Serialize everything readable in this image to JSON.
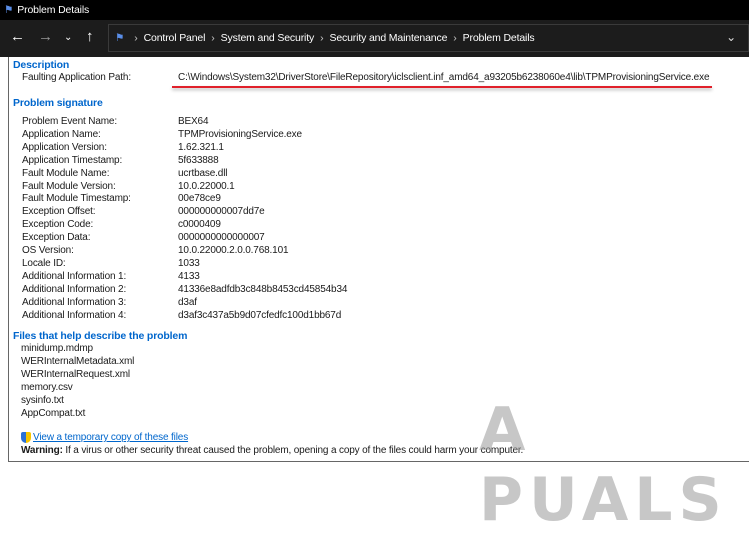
{
  "window": {
    "title": "Problem Details"
  },
  "breadcrumb": [
    "Control Panel",
    "System and Security",
    "Security and Maintenance",
    "Problem Details"
  ],
  "description": {
    "heading": "Description",
    "label": "Faulting Application Path:",
    "value": "C:\\Windows\\System32\\DriverStore\\FileRepository\\iclsclient.inf_amd64_a93205b6238060e4\\lib\\TPMProvisioningService.exe"
  },
  "signature": {
    "heading": "Problem signature",
    "rows": [
      {
        "label": "Problem Event Name:",
        "value": "BEX64"
      },
      {
        "label": "Application Name:",
        "value": "TPMProvisioningService.exe"
      },
      {
        "label": "Application Version:",
        "value": "1.62.321.1"
      },
      {
        "label": "Application Timestamp:",
        "value": "5f633888"
      },
      {
        "label": "Fault Module Name:",
        "value": "ucrtbase.dll"
      },
      {
        "label": "Fault Module Version:",
        "value": "10.0.22000.1"
      },
      {
        "label": "Fault Module Timestamp:",
        "value": "00e78ce9"
      },
      {
        "label": "Exception Offset:",
        "value": "000000000007dd7e"
      },
      {
        "label": "Exception Code:",
        "value": "c0000409"
      },
      {
        "label": "Exception Data:",
        "value": "0000000000000007"
      },
      {
        "label": "OS Version:",
        "value": "10.0.22000.2.0.0.768.101"
      },
      {
        "label": "Locale ID:",
        "value": "1033"
      },
      {
        "label": "Additional Information 1:",
        "value": "4133"
      },
      {
        "label": "Additional Information 2:",
        "value": "41336e8adfdb3c848b8453cd45854b34"
      },
      {
        "label": "Additional Information 3:",
        "value": "d3af"
      },
      {
        "label": "Additional Information 4:",
        "value": "d3af3c437a5b9d07cfedfc100d1bb67d"
      }
    ]
  },
  "files": {
    "heading": "Files that help describe the problem",
    "items": [
      "minidump.mdmp",
      "WERInternalMetadata.xml",
      "WERInternalRequest.xml",
      "memory.csv",
      "sysinfo.txt",
      "AppCompat.txt"
    ]
  },
  "link": "View a temporary copy of these files",
  "warning": {
    "bold": "Warning:",
    "text": " If a virus or other security threat caused the problem, opening a copy of the files could harm your computer."
  },
  "watermark": "APPUALS"
}
